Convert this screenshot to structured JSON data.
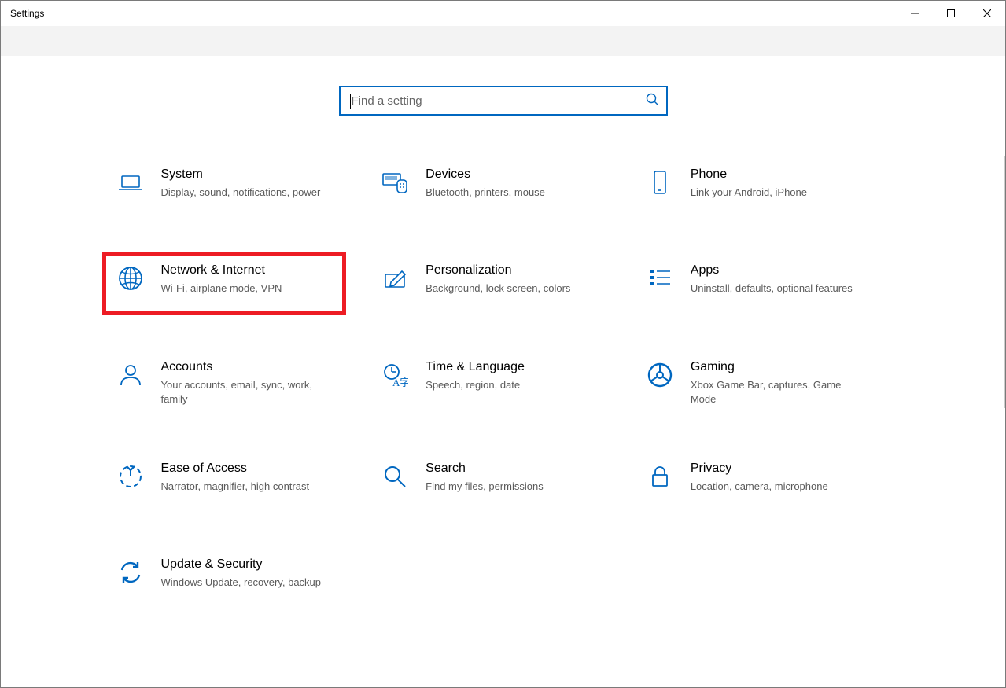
{
  "window": {
    "title": "Settings"
  },
  "search": {
    "placeholder": "Find a setting"
  },
  "categories": [
    {
      "id": "system",
      "icon": "laptop",
      "title": "System",
      "sub": "Display, sound, notifications, power"
    },
    {
      "id": "devices",
      "icon": "devices",
      "title": "Devices",
      "sub": "Bluetooth, printers, mouse"
    },
    {
      "id": "phone",
      "icon": "phone",
      "title": "Phone",
      "sub": "Link your Android, iPhone"
    },
    {
      "id": "network",
      "icon": "globe",
      "title": "Network & Internet",
      "sub": "Wi-Fi, airplane mode, VPN",
      "highlight": true
    },
    {
      "id": "personalization",
      "icon": "pen",
      "title": "Personalization",
      "sub": "Background, lock screen, colors"
    },
    {
      "id": "apps",
      "icon": "apps",
      "title": "Apps",
      "sub": "Uninstall, defaults, optional features"
    },
    {
      "id": "accounts",
      "icon": "person",
      "title": "Accounts",
      "sub": "Your accounts, email, sync, work, family"
    },
    {
      "id": "time",
      "icon": "time",
      "title": "Time & Language",
      "sub": "Speech, region, date"
    },
    {
      "id": "gaming",
      "icon": "gaming",
      "title": "Gaming",
      "sub": "Xbox Game Bar, captures, Game Mode"
    },
    {
      "id": "ease",
      "icon": "ease",
      "title": "Ease of Access",
      "sub": "Narrator, magnifier, high contrast"
    },
    {
      "id": "search",
      "icon": "search",
      "title": "Search",
      "sub": "Find my files, permissions"
    },
    {
      "id": "privacy",
      "icon": "privacy",
      "title": "Privacy",
      "sub": "Location, camera, microphone"
    },
    {
      "id": "update",
      "icon": "update",
      "title": "Update & Security",
      "sub": "Windows Update, recovery, backup"
    }
  ]
}
